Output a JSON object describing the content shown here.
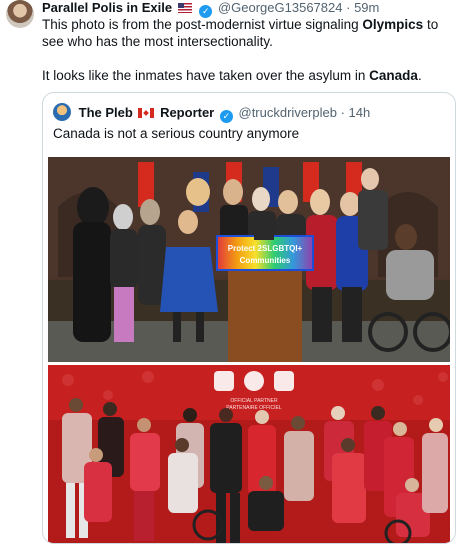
{
  "tweet": {
    "author_name": "Parallel Polis in Exile",
    "author_flag": "🇺🇸",
    "handle": "@GeorgeG13567824",
    "separator": "·",
    "time": "59m",
    "text_line1_pre": "This photo is from the post-modernist virtue signaling ",
    "text_line1_bold": "Olympics",
    "text_line1_post": " to see who has the most intersectionality.",
    "text_line2_pre": "It looks like the inmates have taken over the asylum in ",
    "text_line2_bold": "Canada",
    "text_line2_post": "."
  },
  "quote": {
    "author_name": "The Pleb",
    "author_name_suffix": "Reporter",
    "handle": "@truckdriverpleb",
    "separator": "·",
    "time": "14h",
    "text": "Canada is not a serious country anymore",
    "image1": {
      "podium_sign_line1": "Protect 2SLGBTQI+",
      "podium_sign_line2": "Communities"
    },
    "image2": {
      "backdrop_text_line1": "OFFICIAL PARTNER",
      "backdrop_text_line2": "PARTENAIRE OFFICIEL"
    }
  },
  "colors": {
    "verified": "#1d9bf0",
    "muted": "#536471",
    "border": "#cfd9de",
    "red_backdrop": "#b31b1b"
  }
}
